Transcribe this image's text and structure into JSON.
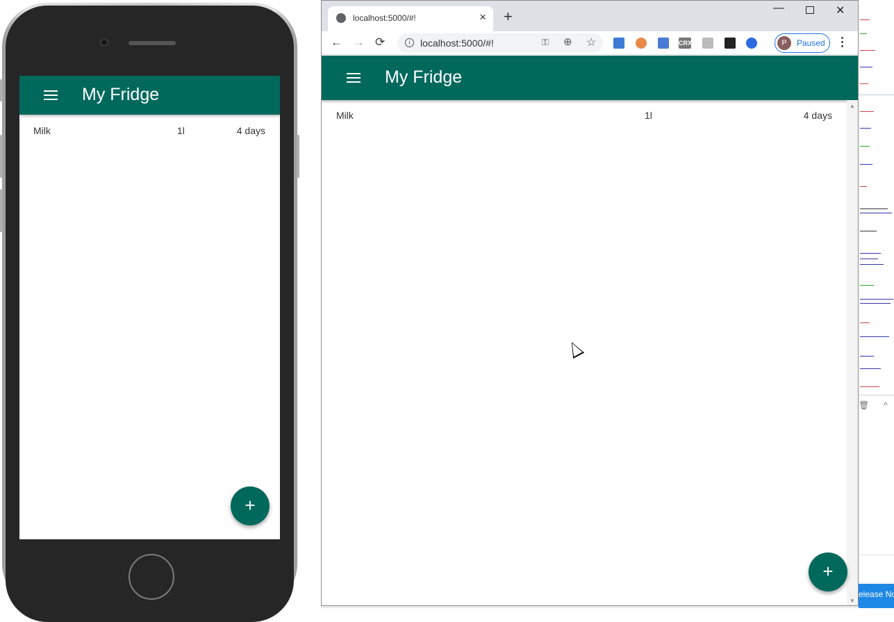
{
  "phone_app": {
    "title": "My Fridge",
    "items": [
      {
        "name": "Milk",
        "quantity": "1l",
        "expires": "4 days"
      }
    ],
    "fab_label": "+"
  },
  "browser": {
    "tab": {
      "title": "localhost:5000/#!",
      "close": "×"
    },
    "new_tab": "+",
    "window_controls": {
      "minimize": "—",
      "close": "✕"
    },
    "toolbar": {
      "back": "←",
      "forward": "→",
      "reload": "⟳",
      "url": "localhost:5000/#!",
      "extensions": [
        "CRX"
      ],
      "profile_initial": "P",
      "profile_label": "Paused"
    },
    "app": {
      "title": "My Fridge",
      "items": [
        {
          "name": "Milk",
          "quantity": "1l",
          "expires": "4 days"
        }
      ],
      "fab_label": "+"
    }
  },
  "background_editor": {
    "footer_text": "elease Not"
  },
  "colors": {
    "primary": "#00695c",
    "tabstrip": "#dee1e6",
    "profile_accent": "#1a73e8"
  },
  "icons": [
    "menu-icon",
    "globe-icon",
    "close-icon",
    "back-icon",
    "forward-icon",
    "reload-icon",
    "info-icon",
    "key-icon",
    "zoom-icon",
    "star-icon",
    "kebab-menu-icon",
    "add-icon",
    "cursor-icon"
  ]
}
